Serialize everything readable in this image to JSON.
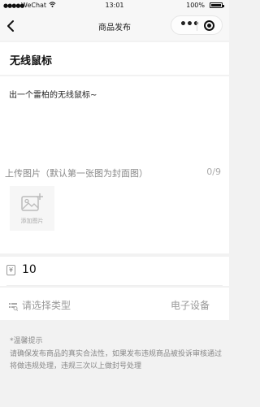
{
  "status_bar": {
    "signal": "●●●●●",
    "carrier": "WeChat",
    "time": "13:01",
    "battery": "100%"
  },
  "nav": {
    "title": "商品发布",
    "more": "•••"
  },
  "product": {
    "name": "无线鼠标",
    "description": "出一个雷柏的无线鼠标~"
  },
  "upload": {
    "label": "上传图片（默认第一张图为封面图）",
    "count": "0/9",
    "add_label": "添加图片"
  },
  "price": {
    "icon": "¥",
    "value": "10"
  },
  "type": {
    "placeholder": "请选择类型",
    "selected": "电子设备"
  },
  "notice": {
    "heading": "*温馨提示",
    "body": "请确保发布商品的真实合法性，如果发布违规商品被投诉审核通过将做违规处理，违规三次以上做封号处理"
  },
  "colors": {
    "background": "#f2f2f2",
    "card": "#ffffff",
    "muted_text": "#888888"
  }
}
